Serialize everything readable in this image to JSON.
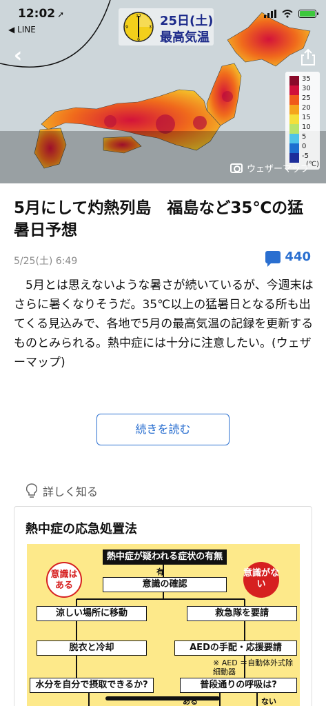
{
  "status_bar": {
    "time": "12:02",
    "back_app": "◀ LINE"
  },
  "map": {
    "date": "25日(土)",
    "label": "最高気温",
    "clock_numbers": [
      "12",
      "3",
      "6",
      "9"
    ],
    "legend": [
      "35",
      "30",
      "25",
      "20",
      "15",
      "10",
      "5",
      "0",
      "-5",
      "(℃)"
    ],
    "legend_colors": [
      "#8a0a2a",
      "#d0103a",
      "#f05a1a",
      "#f5a51c",
      "#f5e03a",
      "#b9e36a",
      "#4fc3e8",
      "#1e6fd0",
      "#1d2e9a"
    ],
    "credit": "ウェザーマップ"
  },
  "article": {
    "title": "5月にして灼熱列島　福島など35℃の猛暑日予想",
    "date": "5/25(土) 6:49",
    "comment_count": "440",
    "body": "5月とは思えないような暑さが続いているが、今週末はさらに暑くなりそうだ。35℃以上の猛暑日となる所も出てくる見込みで、各地で5月の最高気温の記録を更新するものとみられる。熱中症には十分に注意したい。(ウェザーマップ)",
    "read_more": "続きを読む"
  },
  "detail": {
    "heading": "詳しく知る",
    "card_title": "熱中症の応急処置法",
    "flow": {
      "top": "熱中症が疑われる症状の有無",
      "yes_small": "有",
      "check": "意識の確認",
      "badge_conscious": "意識はある",
      "badge_unconscious": "意識がない",
      "left1": "涼しい場所に移動",
      "right1": "救急隊を要請",
      "left2": "脱衣と冷却",
      "right2": "AEDの手配・応援要請",
      "aed_note": "※ AED ＝自動体外式除細動器",
      "left3": "水分を自分で摂取できるか?",
      "right3": "普段通りの呼吸は?",
      "aru": "ある",
      "nai": "ない"
    }
  }
}
